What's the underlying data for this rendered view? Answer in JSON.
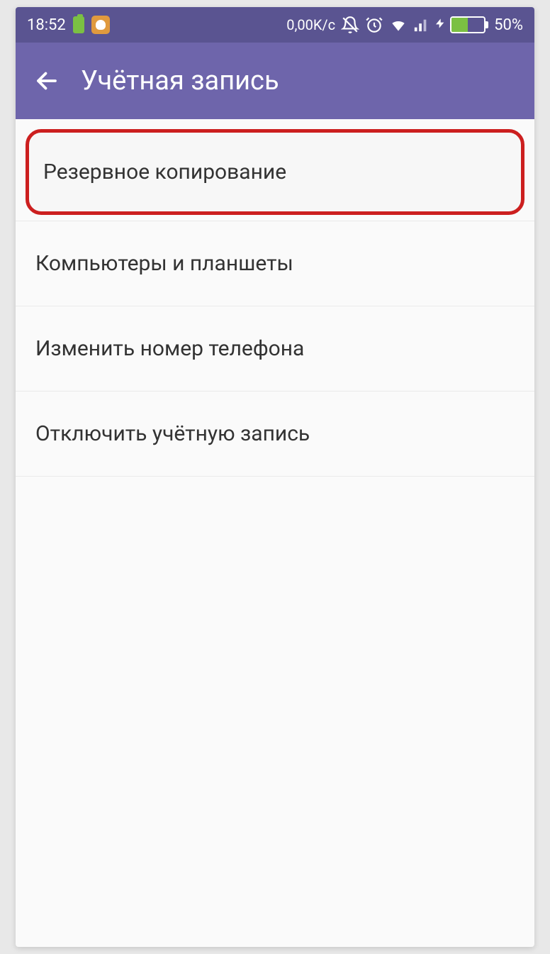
{
  "status_bar": {
    "time": "18:52",
    "net_speed": "0,00K/c",
    "battery_percent": "50%"
  },
  "header": {
    "title": "Учётная запись"
  },
  "menu": {
    "items": [
      {
        "label": "Резервное копирование",
        "highlighted": true
      },
      {
        "label": "Компьютеры и планшеты",
        "highlighted": false
      },
      {
        "label": "Изменить номер телефона",
        "highlighted": false
      },
      {
        "label": "Отключить учётную запись",
        "highlighted": false
      }
    ]
  }
}
